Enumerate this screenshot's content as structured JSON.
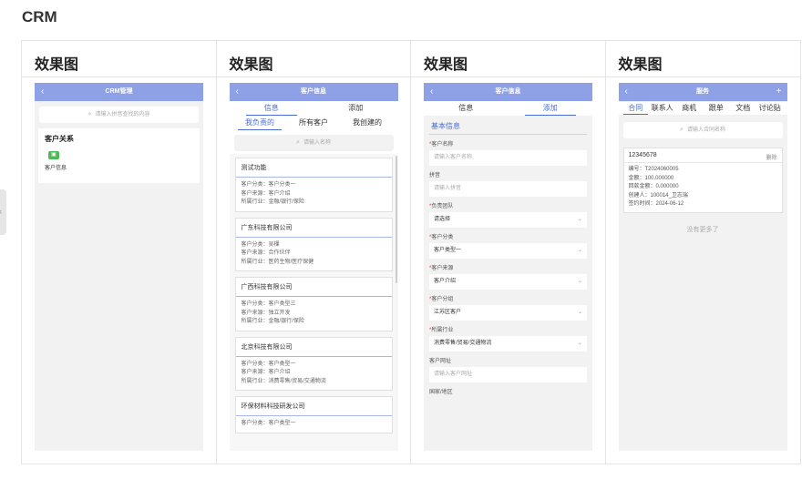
{
  "page": {
    "title": "CRM"
  },
  "side_tab": {
    "glyph": "‹"
  },
  "panels": [
    {
      "heading": "效果图"
    },
    {
      "heading": "效果图"
    },
    {
      "heading": "效果图"
    },
    {
      "heading": "效果图"
    }
  ],
  "icons": {
    "back": "‹",
    "search": "⌕",
    "chevron": "⌄",
    "plus": "+",
    "contacts": "▣"
  },
  "phone1": {
    "nav_title": "CRM管理",
    "search_placeholder": "请输入拼音查找的内容",
    "section_title": "客户关系",
    "item_label": "客户信息"
  },
  "phone2": {
    "nav_title": "客户信息",
    "tabs": [
      "信息",
      "添加"
    ],
    "subtabs": [
      "我负责的",
      "所有客户",
      "我创建的"
    ],
    "search_placeholder": "请输入名称",
    "customers": [
      {
        "name": "测试功能",
        "lines": [
          "客户分类：客户分类一",
          "客户来源：客户介绍",
          "所属行业：金融/银行/保险"
        ]
      },
      {
        "name": "广东科技有限公司",
        "lines": [
          "客户分类：吴棵",
          "客户来源：合作伙伴",
          "所属行业：医药生物/医疗保健"
        ]
      },
      {
        "name": "广西科技有限公司",
        "lines": [
          "客户分类：客户类型三",
          "客户来源：独立开发",
          "所属行业：金融/银行/保险"
        ]
      },
      {
        "name": "北京科技有限公司",
        "lines": [
          "客户分类：客户类型一",
          "客户来源：客户介绍",
          "所属行业：消费零售/贸易/交通物流"
        ]
      },
      {
        "name": "环保材料科技研发公司",
        "lines": [
          "客户分类：客户类型一"
        ]
      }
    ]
  },
  "phone3": {
    "nav_title": "客户信息",
    "tabs": [
      "信息",
      "添加"
    ],
    "section": "基本信息",
    "fields": [
      {
        "label": "客户名称",
        "required": "*",
        "value": "请输入客户名称",
        "filled": false,
        "select": false
      },
      {
        "label": "拼音",
        "required": "",
        "value": "请输入拼音",
        "filled": false,
        "select": false
      },
      {
        "label": "负责团队",
        "required": "*",
        "value": "请选择",
        "filled": true,
        "select": true
      },
      {
        "label": "客户分类",
        "required": "*",
        "value": "客户类型一",
        "filled": true,
        "select": true
      },
      {
        "label": "客户来源",
        "required": "*",
        "value": "客户介绍",
        "filled": true,
        "select": true
      },
      {
        "label": "客户分组",
        "required": "*",
        "value": "江苏区客户",
        "filled": true,
        "select": true
      },
      {
        "label": "所属行业",
        "required": "*",
        "value": "消费零售/贸易/交通物流",
        "filled": true,
        "select": true
      },
      {
        "label": "客户网址",
        "required": "",
        "value": "请输入客户网址",
        "filled": false,
        "select": false
      },
      {
        "label": "国家/地区",
        "required": "",
        "value": "",
        "filled": false,
        "select": false
      }
    ]
  },
  "phone4": {
    "nav_title": "服务",
    "tabs": [
      "合同",
      "联系人",
      "商机",
      "跟单",
      "文档",
      "讨论贴"
    ],
    "search_placeholder": "请输入合同名称",
    "contract": {
      "number": "12345678",
      "delete_label": "删除",
      "lines": [
        "编号：T2024060005",
        "金额：100.000000",
        "回款金额：0.000000",
        "创建人：100014_卫志瑞",
        "签约时间：2024-06-12"
      ]
    },
    "no_more": "没有更多了"
  }
}
